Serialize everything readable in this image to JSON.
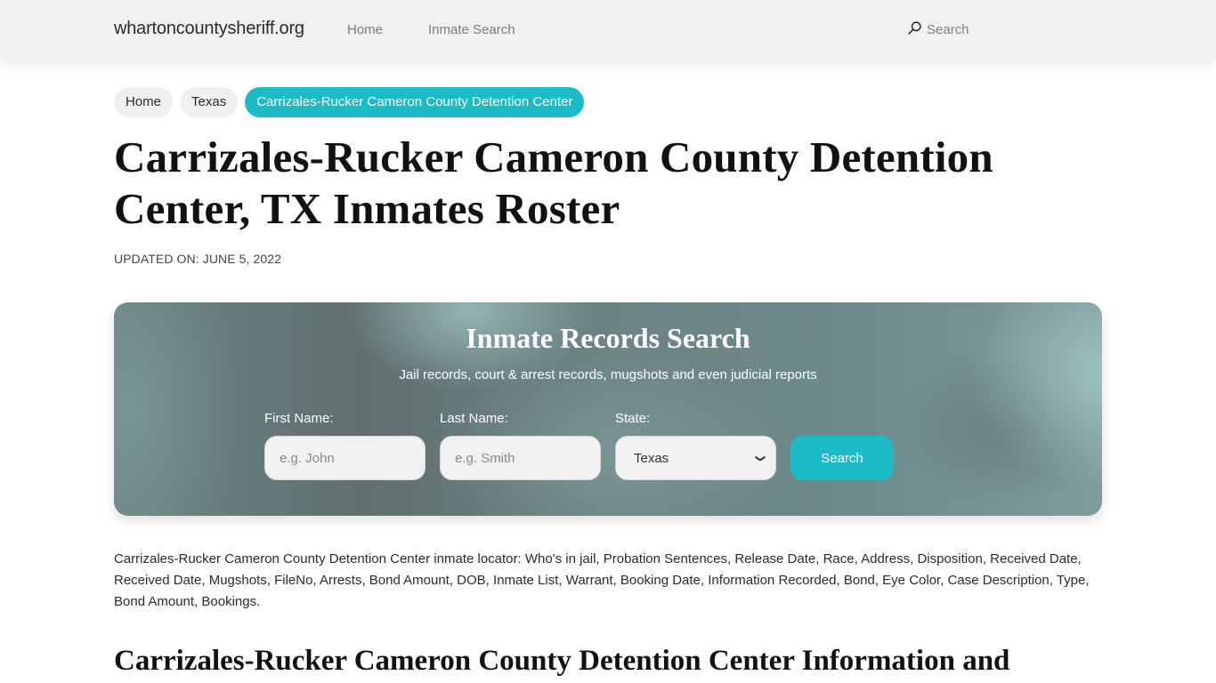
{
  "header": {
    "brand": "whartoncountysheriff.org",
    "nav": [
      {
        "label": "Home"
      },
      {
        "label": "Inmate Search"
      }
    ],
    "search_label": "Search",
    "search_icon": "search-icon"
  },
  "breadcrumb": [
    {
      "label": "Home"
    },
    {
      "label": "Texas"
    },
    {
      "label": "Carrizales-Rucker Cameron County Detention Center",
      "active": true
    }
  ],
  "page": {
    "title": "Carrizales-Rucker Cameron County Detention Center, TX Inmates Roster",
    "updated": "UPDATED ON: JUNE 5, 2022"
  },
  "search_card": {
    "title": "Inmate Records Search",
    "subtitle": "Jail records, court & arrest records, mugshots and even judicial reports",
    "first_name": {
      "label": "First Name:",
      "placeholder": "e.g. John",
      "value": ""
    },
    "last_name": {
      "label": "Last Name:",
      "placeholder": "e.g. Smith",
      "value": ""
    },
    "state": {
      "label": "State:",
      "selected": "Texas"
    },
    "button_label": "Search",
    "accent_color": "#1bbcc8"
  },
  "content": {
    "intro": "Carrizales-Rucker Cameron County Detention Center inmate locator: Who's in jail, Probation Sentences, Release Date, Race, Address, Disposition, Received Date, Received Date, Mugshots, FileNo, Arrests, Bond Amount, DOB, Inmate List, Warrant, Booking Date, Information Recorded, Bond, Eye Color, Case Description, Type, Bond Amount, Bookings.",
    "section_title": "Carrizales-Rucker Cameron County Detention Center Information and"
  }
}
